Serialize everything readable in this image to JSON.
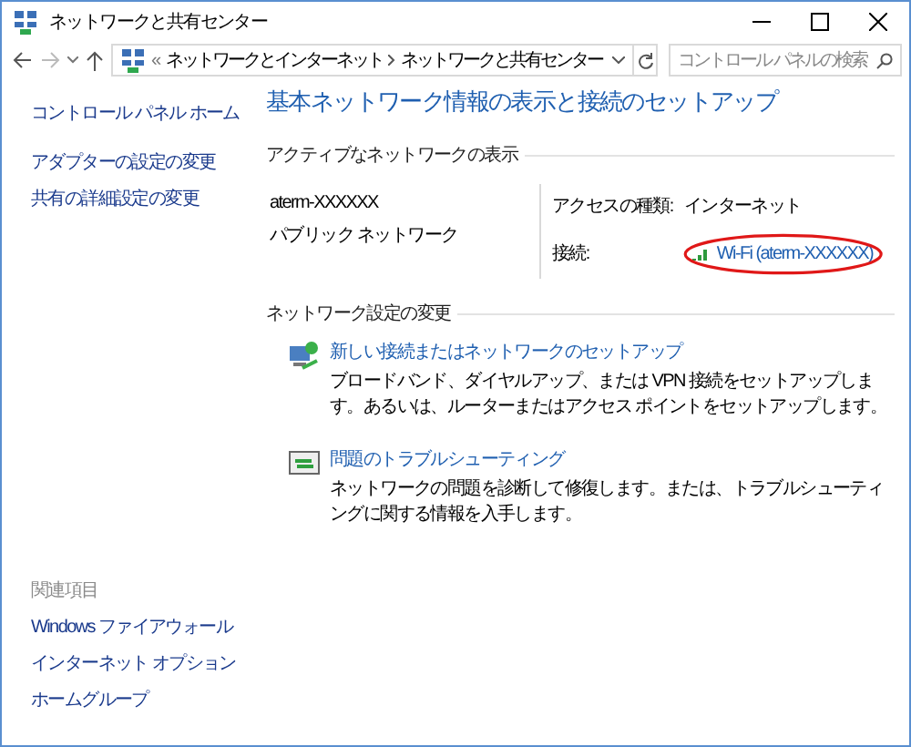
{
  "window": {
    "title": "ネットワークと共有センター"
  },
  "address_bar": {
    "separator": "«",
    "crumbs": [
      "ネットワークとインターネット",
      "ネットワークと共有センター"
    ],
    "search_placeholder": "コントロール パネルの検索"
  },
  "sidebar": {
    "items": [
      "コントロール パネル ホーム",
      "アダプターの設定の変更",
      "共有の詳細設定の変更"
    ],
    "related_heading": "関連項目",
    "related_items": [
      "Windows ファイアウォール",
      "インターネット オプション",
      "ホームグループ"
    ]
  },
  "heading": "基本ネットワーク情報の表示と接続のセットアップ",
  "active_networks": {
    "section_title": "アクティブなネットワークの表示",
    "network_name": "aterm-XXXXXX",
    "network_type": "パブリック ネットワーク",
    "access_label": "アクセスの種類:",
    "access_value": "インターネット",
    "connection_label": "接続:",
    "connection_value": "Wi-Fi (aterm-XXXXXX)",
    "highlighted": true
  },
  "settings": {
    "section_title": "ネットワーク設定の変更",
    "tasks": [
      {
        "kind": "setup",
        "title": "新しい接続またはネットワークのセットアップ",
        "description": "ブロードバンド、ダイヤルアップ、または VPN 接続をセットアップします。あるいは、ルーターまたはアクセス ポイントをセットアップします。"
      },
      {
        "kind": "troubleshoot",
        "title": "問題のトラブルシューティング",
        "description": "ネットワークの問題を診断して修復します。または、トラブルシューティングに関する情報を入手します。"
      }
    ]
  }
}
